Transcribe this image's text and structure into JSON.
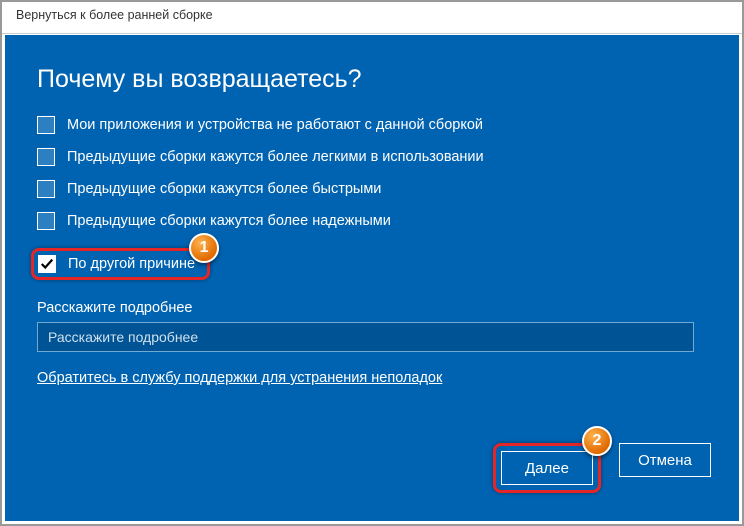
{
  "titlebar": "Вернуться к более ранней сборке",
  "heading": "Почему вы возвращаетесь?",
  "options": [
    {
      "label": "Мои приложения и устройства не работают с данной сборкой",
      "checked": false
    },
    {
      "label": "Предыдущие сборки кажутся более легкими в использовании",
      "checked": false
    },
    {
      "label": "Предыдущие сборки кажутся более быстрыми",
      "checked": false
    },
    {
      "label": "Предыдущие сборки кажутся более надежными",
      "checked": false
    },
    {
      "label": "По другой причине",
      "checked": true
    }
  ],
  "detail": {
    "label": "Расскажите подробнее",
    "placeholder": "Расскажите подробнее",
    "value": ""
  },
  "supportLink": "Обратитесь в службу поддержки для устранения неполадок",
  "buttons": {
    "next": "Далее",
    "cancel": "Отмена"
  },
  "callouts": {
    "c1": "1",
    "c2": "2"
  }
}
